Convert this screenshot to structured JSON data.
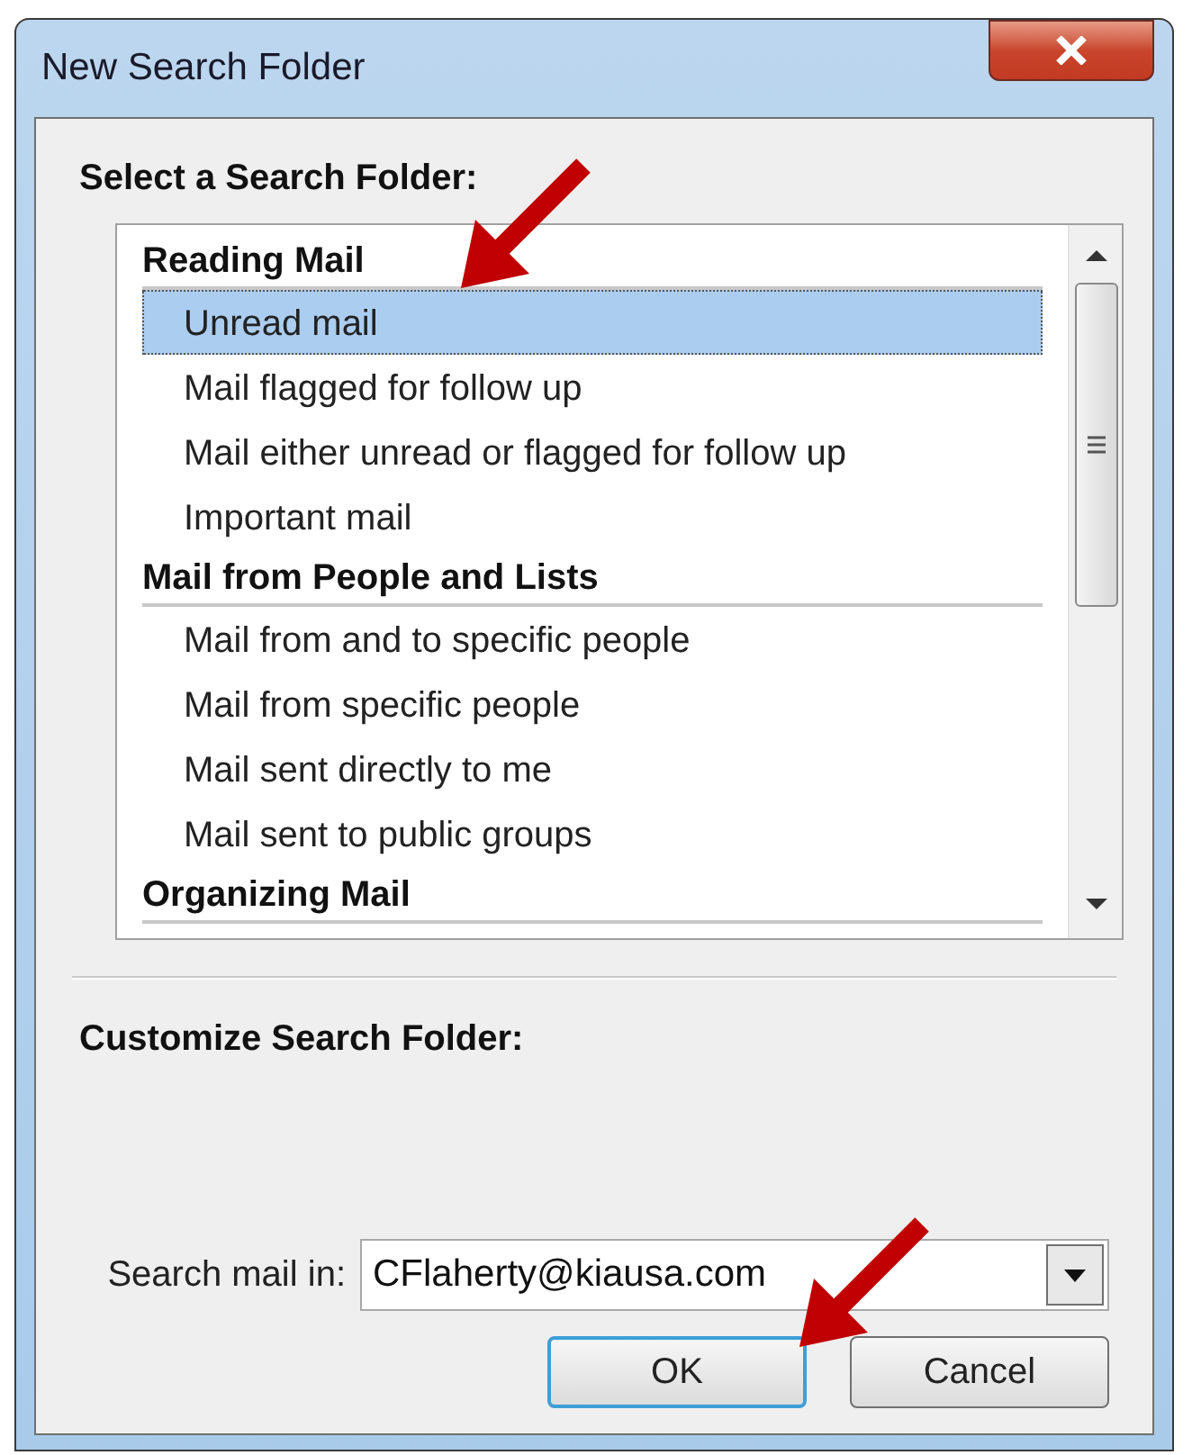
{
  "window": {
    "title": "New Search Folder"
  },
  "select_label": "Select a Search Folder:",
  "groups": [
    {
      "heading": "Reading Mail",
      "items": [
        {
          "label": "Unread mail",
          "selected": true
        },
        {
          "label": "Mail flagged for follow up",
          "selected": false
        },
        {
          "label": "Mail either unread or flagged for follow up",
          "selected": false
        },
        {
          "label": "Important mail",
          "selected": false
        }
      ]
    },
    {
      "heading": "Mail from People and Lists",
      "items": [
        {
          "label": "Mail from and to specific people",
          "selected": false
        },
        {
          "label": "Mail from specific people",
          "selected": false
        },
        {
          "label": "Mail sent directly to me",
          "selected": false
        },
        {
          "label": "Mail sent to public groups",
          "selected": false
        }
      ]
    },
    {
      "heading": "Organizing Mail"
    }
  ],
  "customize_label": "Customize Search Folder:",
  "search_in": {
    "label": "Search mail in:",
    "value": "CFlaherty@kiausa.com"
  },
  "buttons": [
    {
      "label": "OK",
      "default": true
    },
    {
      "label": "Cancel",
      "default": false
    }
  ]
}
